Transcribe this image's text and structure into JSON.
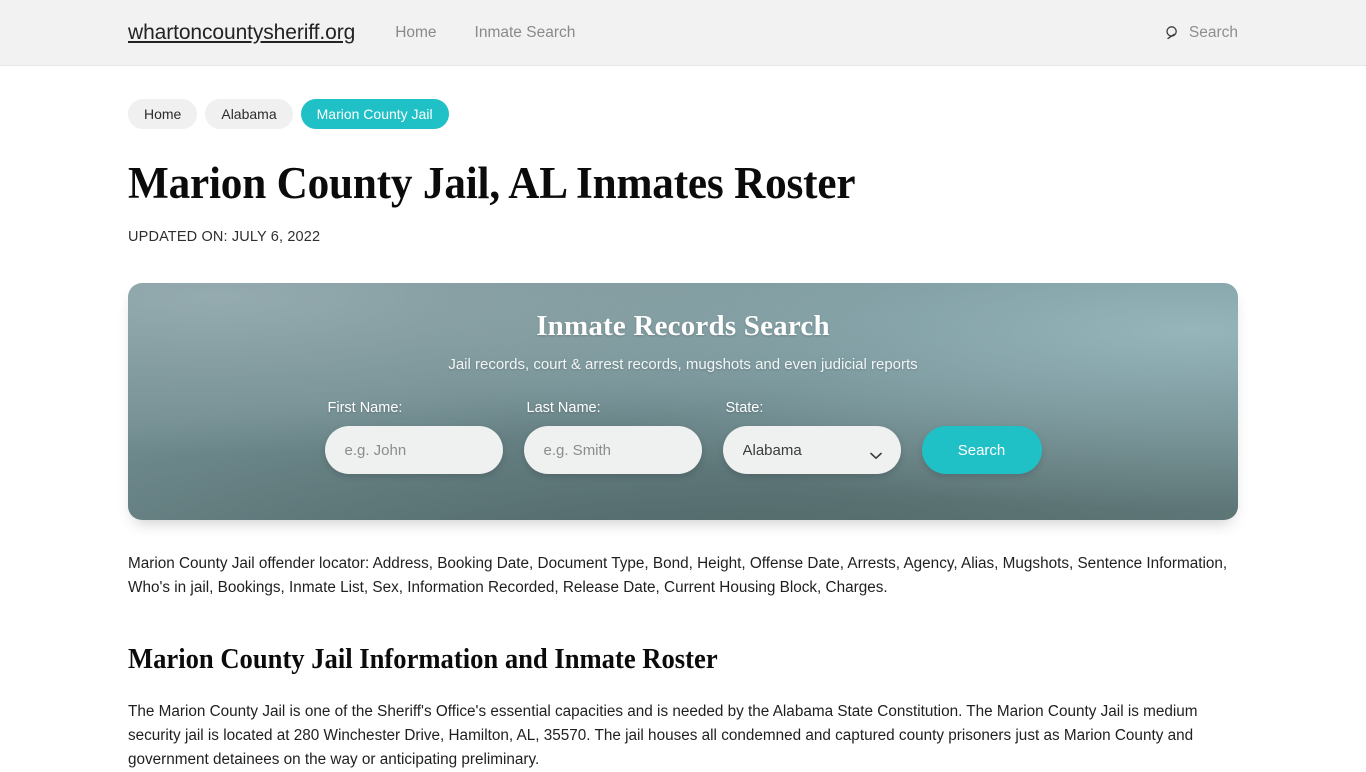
{
  "header": {
    "brand": "whartoncountysheriff.org",
    "nav": [
      {
        "label": "Home"
      },
      {
        "label": "Inmate Search"
      }
    ],
    "search": {
      "icon": "search-icon",
      "label": "Search"
    }
  },
  "breadcrumbs": [
    {
      "label": "Home",
      "active": false
    },
    {
      "label": "Alabama",
      "active": false
    },
    {
      "label": "Marion County Jail",
      "active": true
    }
  ],
  "page": {
    "title": "Marion County Jail, AL Inmates Roster",
    "updated": "UPDATED ON: JULY 6, 2022"
  },
  "hero": {
    "title": "Inmate Records Search",
    "subtitle": "Jail records, court & arrest records, mugshots and even judicial reports",
    "fields": {
      "first_name": {
        "label": "First Name:",
        "placeholder": "e.g. John",
        "value": ""
      },
      "last_name": {
        "label": "Last Name:",
        "placeholder": "e.g. Smith",
        "value": ""
      },
      "state": {
        "label": "State:",
        "selected": "Alabama",
        "options": [
          "Alabama"
        ],
        "chevron_icon": "chevron-down-icon"
      }
    },
    "submit_label": "Search"
  },
  "content": {
    "lede": "Marion County Jail offender locator: Address, Booking Date, Document Type, Bond, Height, Offense Date, Arrests, Agency, Alias, Mugshots, Sentence Information, Who's in jail, Bookings, Inmate List, Sex, Information Recorded, Release Date, Current Housing Block, Charges.",
    "section_heading": "Marion County Jail Information and Inmate Roster",
    "paragraph": "The Marion County Jail is one of the Sheriff's Office's essential capacities and is needed by the Alabama State Constitution. The Marion County Jail is medium security jail is located at 280 Winchester Drive, Hamilton, AL, 35570. The jail houses all condemned and captured county prisoners just as Marion County and government detainees on the way or anticipating preliminary."
  },
  "colors": {
    "accent_teal": "#20c1c6",
    "header_bg": "#f2f2f2",
    "crumb_bg": "#f0f0f0",
    "input_bg": "#eff0f0"
  }
}
